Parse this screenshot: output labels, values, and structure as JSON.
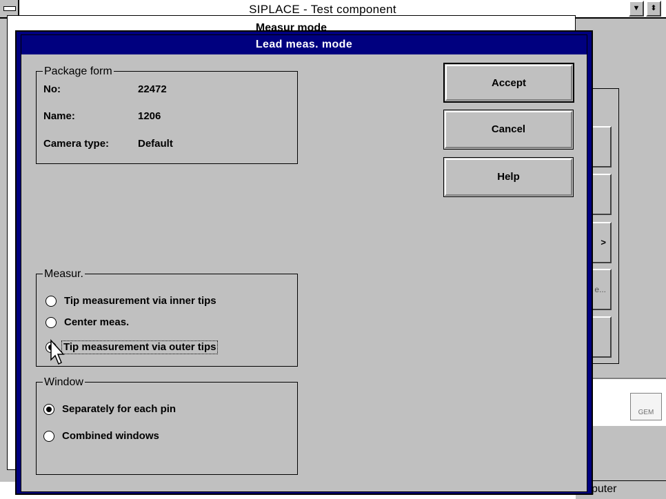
{
  "main_window": {
    "title": "SIPLACE - Test component",
    "min_glyph": "▼",
    "max_glyph": "⬍",
    "status_text": "puter",
    "gem_label": "GEM"
  },
  "measur_window": {
    "title": "Measur mode",
    "side_button_3": ">",
    "side_button_4": "e..."
  },
  "dialog": {
    "title": "Lead meas. mode",
    "package_form": {
      "legend": "Package form",
      "no_label": "No:",
      "no_value": "22472",
      "name_label": "Name:",
      "name_value": "1206",
      "camera_label": "Camera type:",
      "camera_value": "Default"
    },
    "measur": {
      "legend": "Measur.",
      "options": [
        {
          "label": "Tip measurement via inner tips",
          "selected": false
        },
        {
          "label": "Center meas.",
          "selected": false
        },
        {
          "label": "Tip measurement via outer tips",
          "selected": true
        }
      ]
    },
    "window_group": {
      "legend": "Window",
      "options": [
        {
          "label": "Separately for each pin",
          "selected": true
        },
        {
          "label": "Combined windows",
          "selected": false
        }
      ]
    },
    "buttons": {
      "accept": "Accept",
      "cancel": "Cancel",
      "help": "Help"
    }
  },
  "colors": {
    "titlebar_active": "#00007f",
    "face": "#c0c0c0"
  }
}
